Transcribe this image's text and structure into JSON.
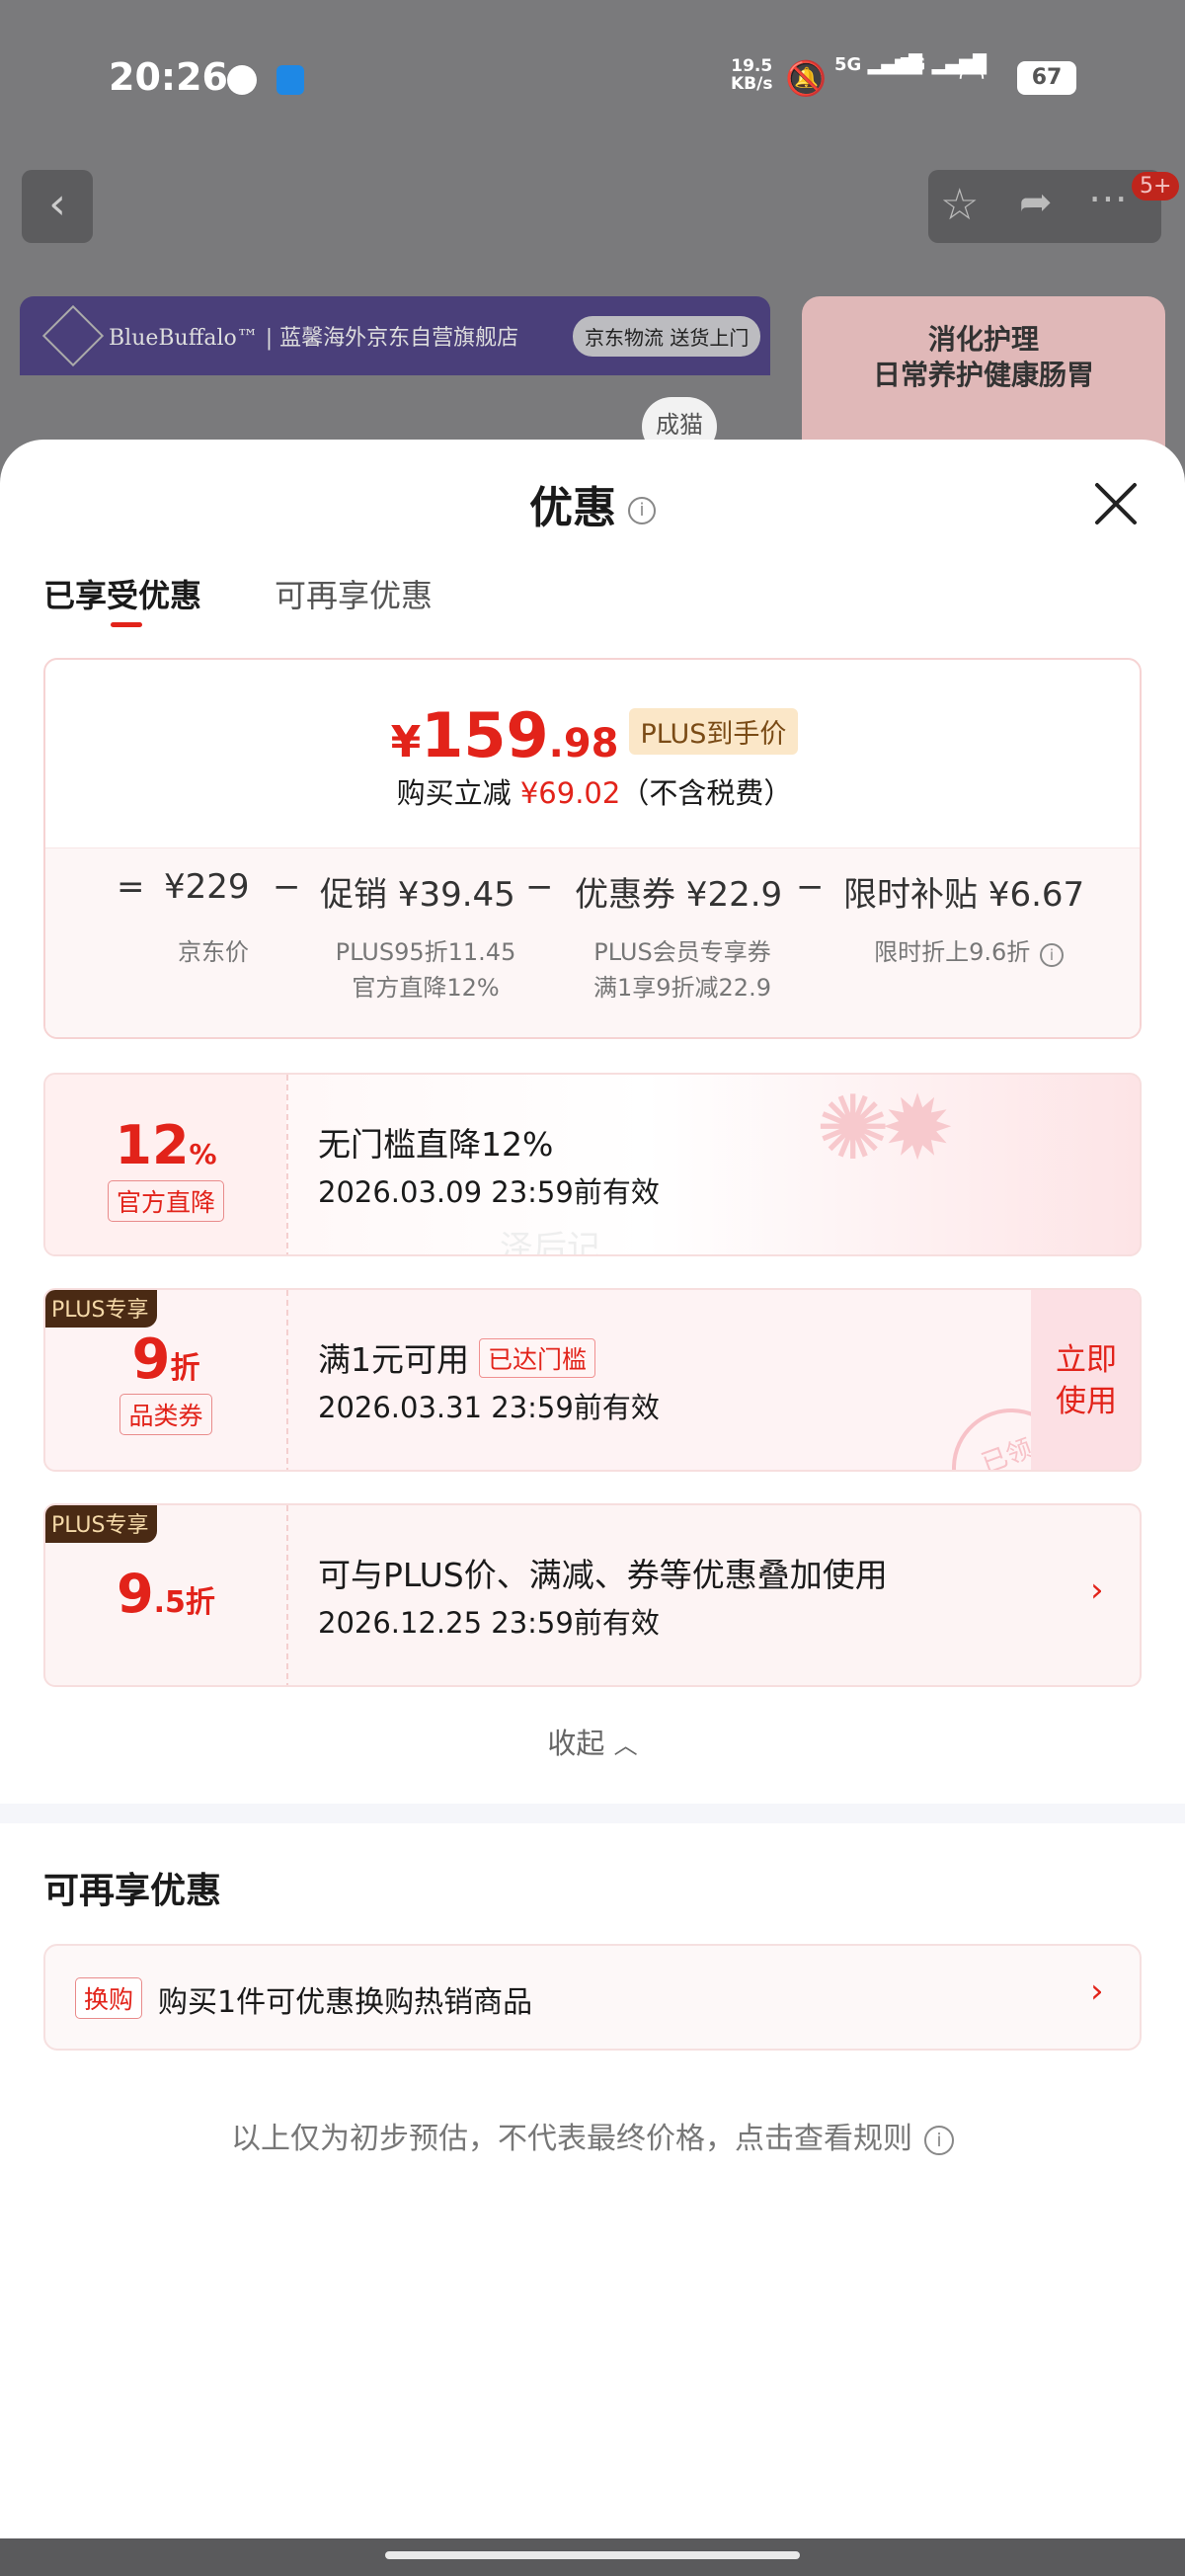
{
  "status": {
    "time": "20:26",
    "netspeed_top": "19.5",
    "netspeed_bottom": "KB/s",
    "signal1": "5G",
    "signal2": "5G",
    "battery": "67"
  },
  "background": {
    "store_banner": "BlueBuffalo™ | 蓝馨海外京东自营旗舰店",
    "logistics": "京东物流 送货上门",
    "right_card_line1": "消化护理",
    "right_card_line2": "日常养护健康肠胃",
    "badge_count": "5+",
    "cat_tag": "成猫"
  },
  "sheet": {
    "title": "优惠",
    "tabs": [
      {
        "label": "已享受优惠",
        "active": true
      },
      {
        "label": "可再享优惠",
        "active": false
      }
    ],
    "summary": {
      "currency": "¥",
      "price_int": "159",
      "price_dec": ".98",
      "plus_label": "PLUS到手价",
      "saving_prefix": "购买立减",
      "saving_value": "¥69.02",
      "saving_suffix": "（不含税费）",
      "formula": [
        {
          "op": "=",
          "amount": "¥229",
          "label": "",
          "notes": [
            "京东价"
          ]
        },
        {
          "op": "−",
          "amount": "促销 ¥39.45",
          "notes": [
            "PLUS95折11.45",
            "官方直降12%"
          ]
        },
        {
          "op": "−",
          "amount": "优惠券 ¥22.9",
          "notes": [
            "PLUS会员专享券",
            "满1享9折减22.9"
          ]
        },
        {
          "op": "−",
          "amount": "限时补贴 ¥6.67",
          "notes": [
            "限时折上9.6折"
          ]
        }
      ]
    },
    "coupons": [
      {
        "big": "12",
        "unit": "%",
        "tag": "官方直降",
        "main": "无门槛直降12%",
        "date": "2026.03.09 23:59前有效",
        "watermark": "泽后记"
      },
      {
        "badge": "PLUS专享",
        "big": "9",
        "unit": "折",
        "tag": "品类券",
        "main": "满1元可用",
        "reached": "已达门槛",
        "date": "2026.03.31 23:59前有效",
        "button": "立即使用",
        "stamp": "已领"
      },
      {
        "badge": "PLUS专享",
        "big": "9",
        "unit": ".5折",
        "main": "可与PLUS价、满减、券等优惠叠加使用",
        "date": "2026.12.25 23:59前有效"
      }
    ],
    "collapse_label": "收起",
    "more_section_title": "可再享优惠",
    "swap": {
      "tag": "换购",
      "text": "购买1件可优惠换购热销商品"
    },
    "footer_note": "以上仅为初步预估，不代表最终价格，点击查看规则"
  },
  "colors": {
    "accent": "#e2231a",
    "plus_bg": "#fbe7c8",
    "badge_bg": "#4a2a14"
  }
}
